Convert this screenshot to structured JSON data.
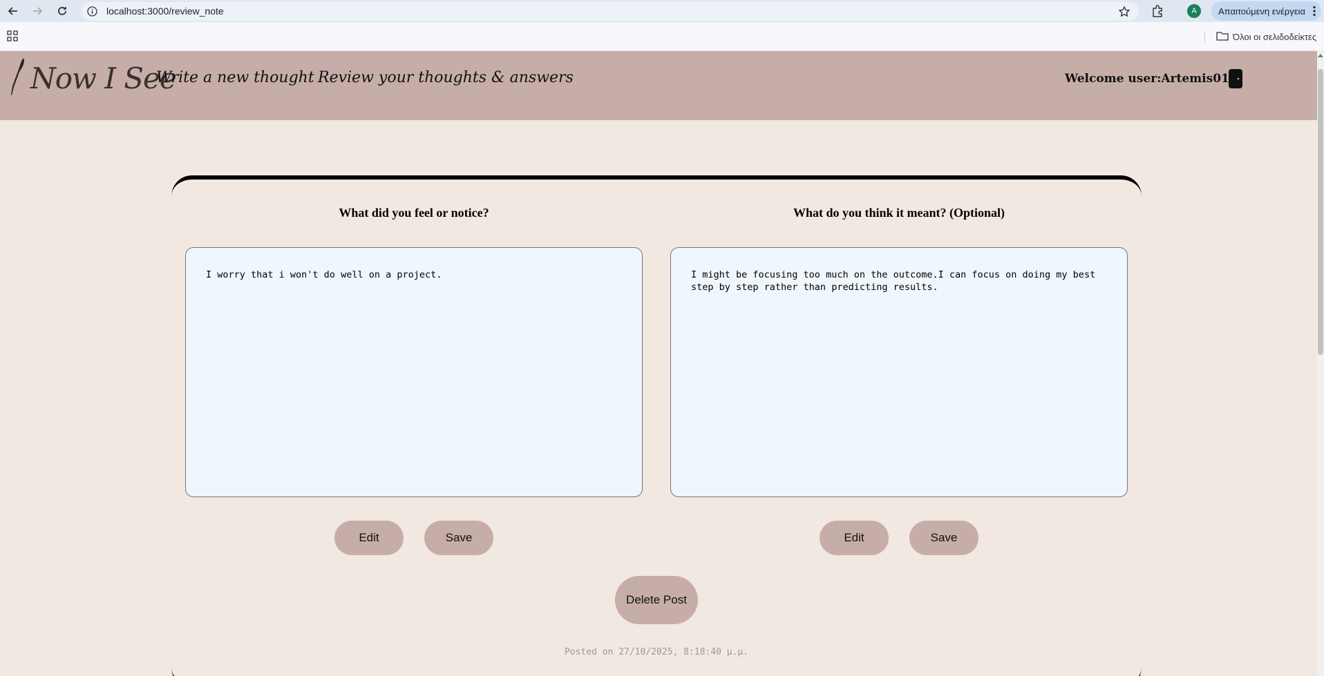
{
  "browser": {
    "url": "localhost:3000/review_note",
    "profile_initial": "A",
    "action_label": "Απαιτούμενη ενέργεια",
    "bookmarks_folder": "Όλοι οι σελιδοδείκτες"
  },
  "header": {
    "logo": "Now I See",
    "nav": [
      "Write a new thought",
      "Review your thoughts & answers"
    ],
    "welcome": "Welcome user:Artemis01"
  },
  "note": {
    "left": {
      "question": "What did you feel or notice?",
      "answer": "I worry that i won't do well on a project.",
      "edit_label": "Edit",
      "save_label": "Save"
    },
    "right": {
      "question": "What do you think it meant? (Optional)",
      "answer": "I might be focusing too much on the outcome.I can focus on doing my best step by step rather than predicting results.",
      "edit_label": "Edit",
      "save_label": "Save"
    },
    "delete_label": "Delete Post",
    "posted": "Posted on 27/10/2025, 8:18:40 μ.μ."
  },
  "colors": {
    "header_bg": "#c6ada8",
    "page_bg": "#f2e8e2",
    "box_bg": "#eff6fc"
  }
}
